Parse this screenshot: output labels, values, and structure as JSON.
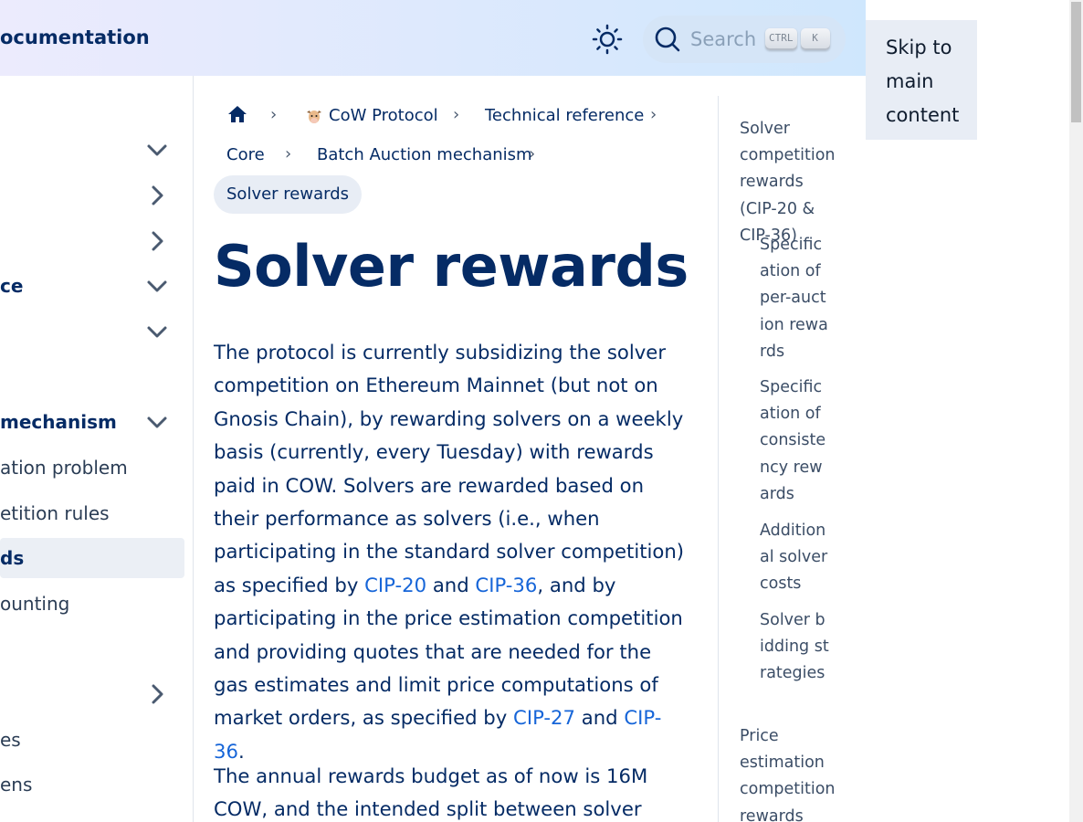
{
  "header": {
    "site_title": "ocumentation",
    "search_placeholder": "Search",
    "shortcut_keys": [
      "CTRL",
      "K"
    ]
  },
  "skip_link": "Skip to main content",
  "sidebar": {
    "items": [
      {
        "label": "",
        "chevron": "down"
      },
      {
        "label": "",
        "chevron": "right"
      },
      {
        "label": "",
        "chevron": "right"
      },
      {
        "label": "ce",
        "chevron": "down"
      },
      {
        "label": "",
        "chevron": "down"
      },
      {
        "label": "mechanism",
        "chevron": "down"
      },
      {
        "label": "ation problem",
        "chevron": ""
      },
      {
        "label": "etition rules",
        "chevron": ""
      },
      {
        "label": "ds",
        "chevron": ""
      },
      {
        "label": "ounting",
        "chevron": ""
      },
      {
        "label": "",
        "chevron": "right"
      },
      {
        "label": "es",
        "chevron": ""
      },
      {
        "label": "ens",
        "chevron": ""
      }
    ]
  },
  "breadcrumbs": {
    "items": [
      "CoW Protocol",
      "Technical reference",
      "Core",
      "Batch Auction mechanism"
    ],
    "current": "Solver rewards"
  },
  "page": {
    "title": "Solver rewards",
    "p1": {
      "t1": "The protocol is currently subsidizing the solver competition on Ethereum Mainnet (but not on Gnosis Chain), by rewarding solvers on a weekly basis (currently, every Tuesday) with rewards paid in COW. Solvers are rewarded based on their performance as solvers (i.e., when participating in the standard solver competition) as specified by ",
      "link1": "CIP-20",
      "t2": " and ",
      "link2": "CIP-36",
      "t3": ", and by participating in the price estimation competition and providing quotes that are needed for the gas estimates and limit price computations of market orders, as specified by ",
      "link3": "CIP-27",
      "t4": " and ",
      "link4": "CIP-36",
      "t5": "."
    },
    "p2": "The annual rewards budget as of now is 16M COW, and the intended split between solver competition"
  },
  "toc": {
    "items": [
      "Solver competition rewards (CIP-20 & CIP-36)",
      "Specification of per-auction rewards",
      "Specification of consistency rewards",
      "Additional solver costs",
      "Solver bidding strategies",
      "Price estimation competition rewards (CIP-"
    ]
  },
  "colors": {
    "text": "#052b65",
    "link": "#1665d8",
    "header_start": "#ecebfd",
    "header_end": "#cfe7fd"
  }
}
